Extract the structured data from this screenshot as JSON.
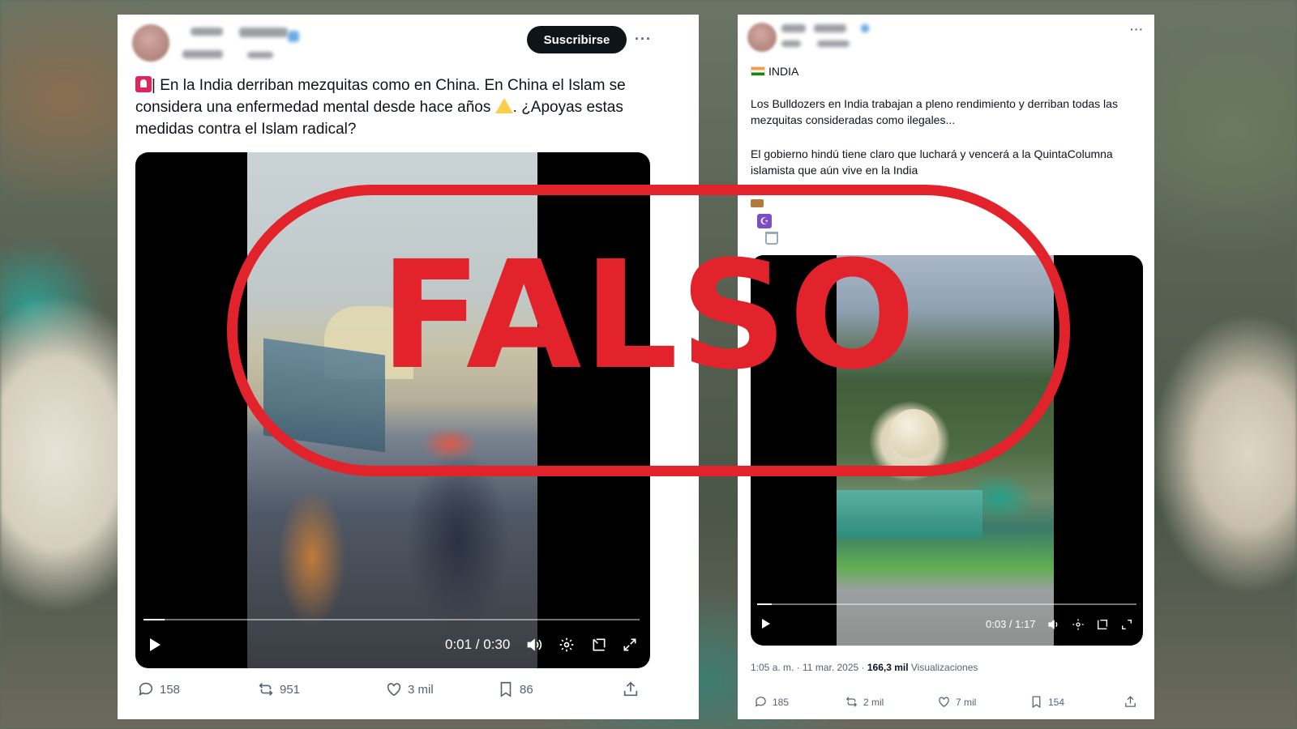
{
  "stamp": {
    "label": "FALSO",
    "color": "#e3232c"
  },
  "left_post": {
    "subscribe_label": "Suscribirse",
    "more_label": "···",
    "text": "| En la India derriban mezquitas como en China. En China el Islam se considera una enfermedad mental desde hace años",
    "text_tail": ". ¿Apoyas estas medidas contra el Islam radical?",
    "video": {
      "time": "0:01 / 0:30",
      "progress": 0.043
    },
    "actions": {
      "replies": "158",
      "reposts": "951",
      "likes": "3 mil",
      "bookmarks": "86"
    }
  },
  "right_post": {
    "more_label": "···",
    "country_label": "INDIA",
    "paragraph1": "Los Bulldozers en India trabajan a pleno rendimiento y derriban todas las mezquitas consideradas como ilegales...",
    "paragraph2": "El gobierno hindú tiene claro que luchará y vencerá a la QuintaColumna islamista que aún vive en la India",
    "video": {
      "time": "0:03 / 1:17",
      "progress": 0.039
    },
    "meta": {
      "timestamp": "1:05 a. m. · 11 mar. 2025 · ",
      "views": "166,3 mil",
      "views_label": " Visualizaciones"
    },
    "actions": {
      "replies": "185",
      "reposts": "2 mil",
      "likes": "7 mil",
      "bookmarks": "154"
    }
  }
}
